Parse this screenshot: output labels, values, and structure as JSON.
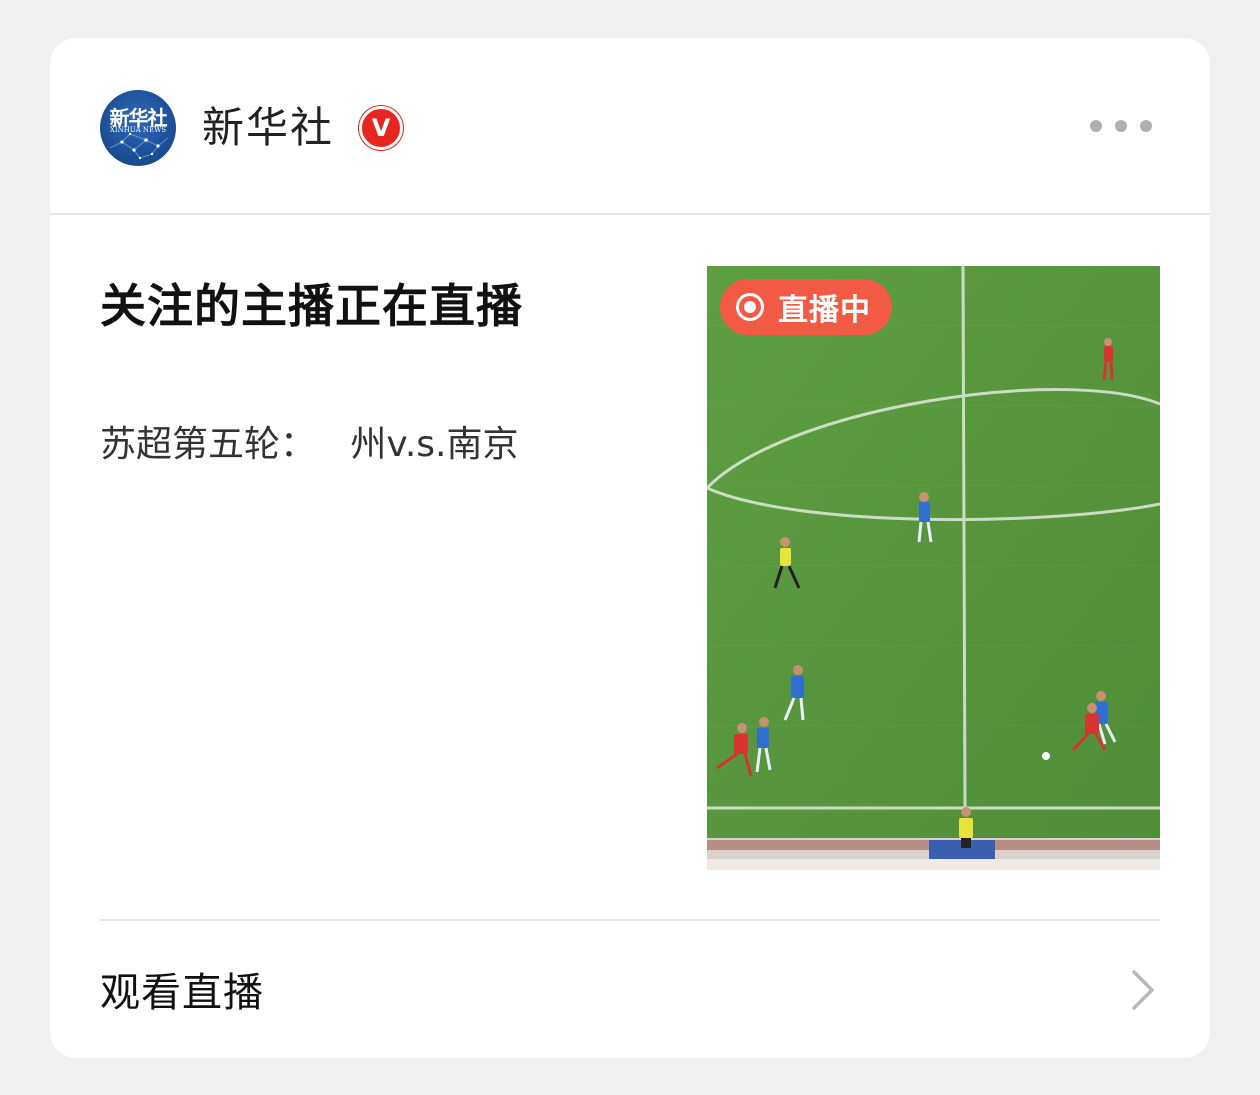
{
  "account": {
    "name": "新华社",
    "verified_mark": "V",
    "avatar": {
      "logo_text": "新华社",
      "logo_subtext": "XINHUA NEWS"
    }
  },
  "post": {
    "title": "关注的主播正在直播",
    "description": "苏超第五轮：   州v.s.南京"
  },
  "thumbnail": {
    "live_badge_label": "直播中",
    "live_icon": "live-record-icon",
    "scene": "football-match-broadcast"
  },
  "footer": {
    "watch_label": "观看直播",
    "chevron_icon": "chevron-right-icon"
  },
  "colors": {
    "live_badge": "#f25a45",
    "verified_badge": "#e8251f",
    "pitch": "#5a9a3f"
  }
}
